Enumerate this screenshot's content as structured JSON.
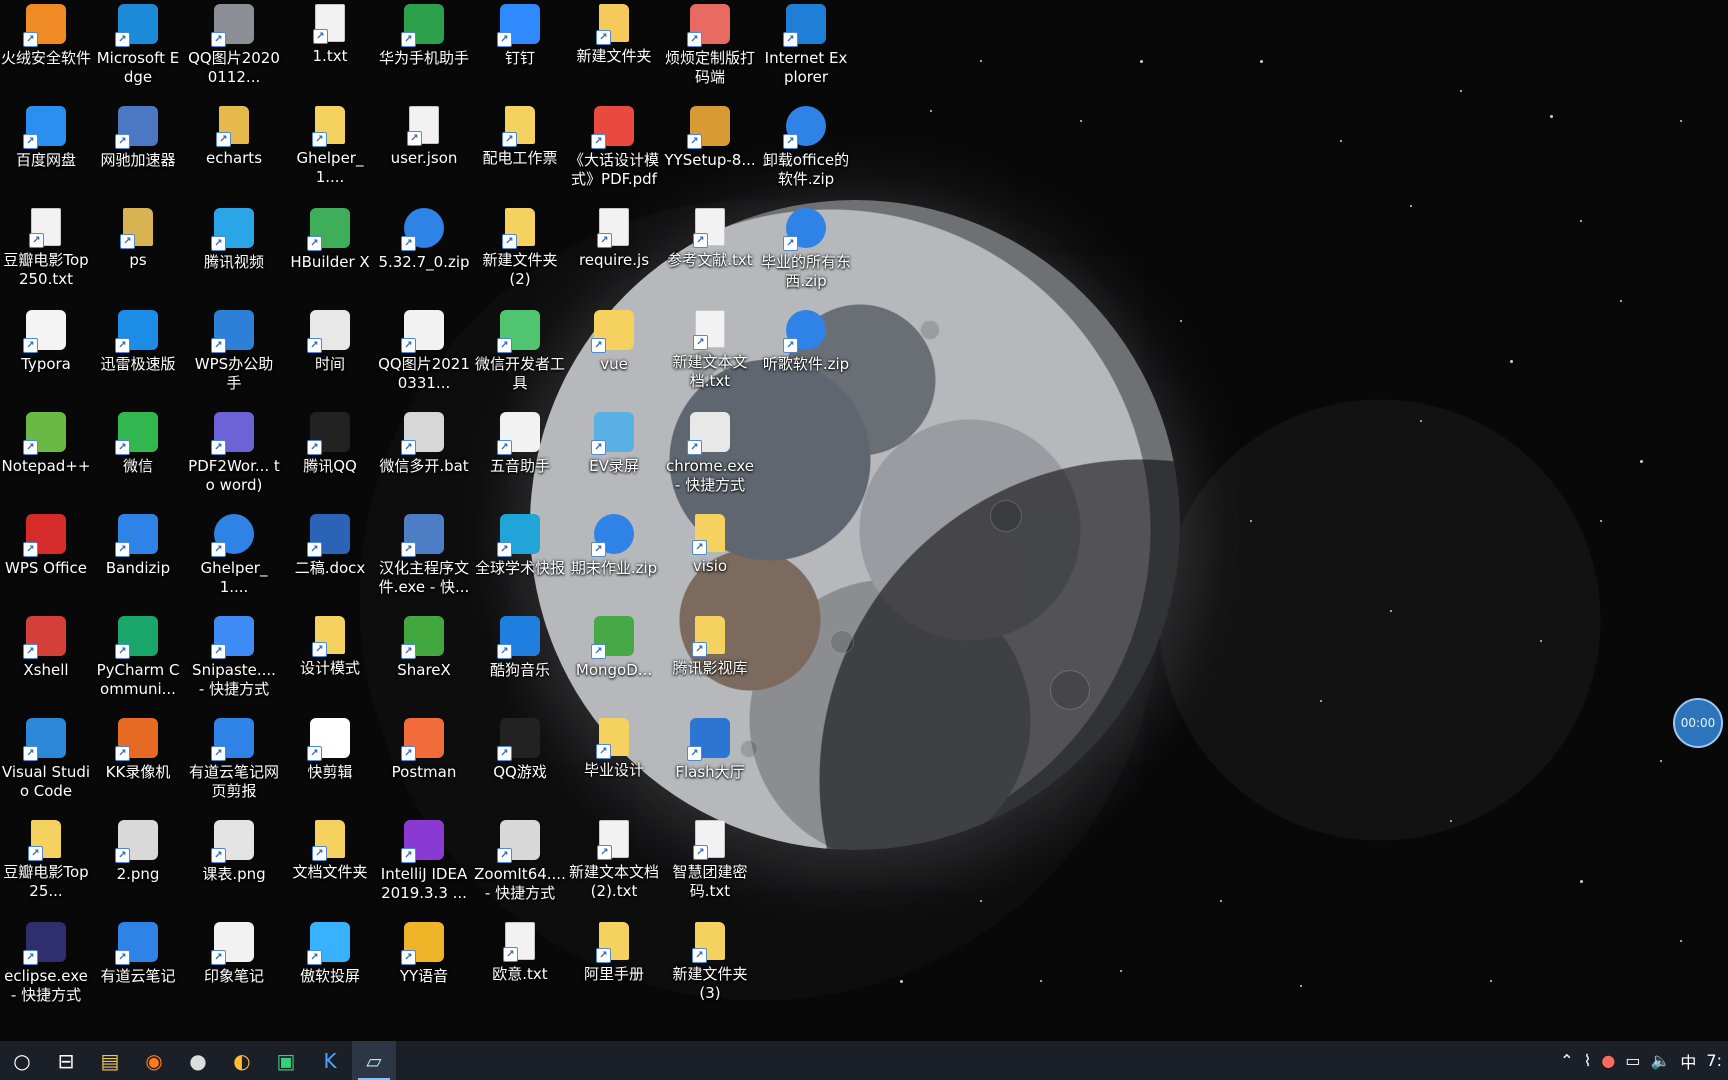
{
  "desktop": {
    "icons": [
      {
        "label": "火绒安全软件",
        "icon": "huorong-icon",
        "color": "#f08a24"
      },
      {
        "label": "Microsoft Edge",
        "icon": "edge-icon",
        "color": "#1b8ad8"
      },
      {
        "label": "QQ图片20200112...",
        "icon": "image-icon",
        "color": "#8c8e96"
      },
      {
        "label": "1.txt",
        "icon": "text-file-icon",
        "color": "#f2f2f2"
      },
      {
        "label": "华为手机助手",
        "icon": "huawei-icon",
        "color": "#2ca04b"
      },
      {
        "label": "钉钉",
        "icon": "dingtalk-icon",
        "color": "#2f89ff"
      },
      {
        "label": "新建文件夹",
        "icon": "folder-icon",
        "color": "#f5ca5b"
      },
      {
        "label": "烦烦定制版打码端",
        "icon": "app-icon",
        "color": "#e86b61"
      },
      {
        "label": "Internet Explorer",
        "icon": "ie-icon",
        "color": "#1f7fd6"
      },
      {
        "label": "百度网盘",
        "icon": "baidu-icon",
        "color": "#2a8ff0"
      },
      {
        "label": "网驰加速器",
        "icon": "vpn-icon",
        "color": "#4c78c3"
      },
      {
        "label": "echarts",
        "icon": "folder-icon",
        "color": "#e6b94d"
      },
      {
        "label": "Ghelper_1....",
        "icon": "folder-icon",
        "color": "#f5d15f"
      },
      {
        "label": "user.json",
        "icon": "json-icon",
        "color": "#f2f2f2"
      },
      {
        "label": "配电工作票",
        "icon": "folder-icon",
        "color": "#f5d15f"
      },
      {
        "label": "《大话设计模式》PDF.pdf",
        "icon": "pdf-icon",
        "color": "#e84a3f"
      },
      {
        "label": "YYSetup-8...",
        "icon": "installer-icon",
        "color": "#d89a35"
      },
      {
        "label": "卸载office的软件.zip",
        "icon": "zip-icon",
        "color": "#2f82e6"
      },
      {
        "label": "豆瓣电影Top 250.txt",
        "icon": "text-file-icon",
        "color": "#f2f2f2"
      },
      {
        "label": "ps",
        "icon": "folder-icon",
        "color": "#d9b352"
      },
      {
        "label": "腾讯视频",
        "icon": "tencent-video-icon",
        "color": "#2aa5e8"
      },
      {
        "label": "HBuilder X",
        "icon": "hbuilder-icon",
        "color": "#3fae5b"
      },
      {
        "label": "5.32.7_0.zip",
        "icon": "zip-icon",
        "color": "#2f82e6"
      },
      {
        "label": "新建文件夹 (2)",
        "icon": "folder-icon",
        "color": "#f5d15f"
      },
      {
        "label": "require.js",
        "icon": "script-icon",
        "color": "#f2f2f2"
      },
      {
        "label": "参考文献.txt",
        "icon": "text-file-icon",
        "color": "#f2f2f2"
      },
      {
        "label": "毕业的所有东西.zip",
        "icon": "zip-icon",
        "color": "#2f82e6"
      },
      {
        "label": "Typora",
        "icon": "typora-icon",
        "color": "#f4f4f4"
      },
      {
        "label": "迅雷极速版",
        "icon": "xunlei-icon",
        "color": "#1d8ce6"
      },
      {
        "label": "WPS办公助手",
        "icon": "wps-helper-icon",
        "color": "#2e7fd8"
      },
      {
        "label": "时间",
        "icon": "chrome-icon",
        "color": "#e8e8e8"
      },
      {
        "label": "QQ图片20210331...",
        "icon": "image-icon",
        "color": "#f2f2f2"
      },
      {
        "label": "微信开发者工具",
        "icon": "wechat-dev-icon",
        "color": "#4fc56f"
      },
      {
        "label": "vue",
        "icon": "chrome-icon",
        "color": "#f5d15f"
      },
      {
        "label": "新建文本文档.txt",
        "icon": "text-file-icon",
        "color": "#f2f2f2"
      },
      {
        "label": "听歌软件.zip",
        "icon": "zip-icon",
        "color": "#2f82e6"
      },
      {
        "label": "Notepad++",
        "icon": "notepad-plus-icon",
        "color": "#69b944"
      },
      {
        "label": "微信",
        "icon": "wechat-icon",
        "color": "#32b64f"
      },
      {
        "label": "PDF2Wor... to word)",
        "icon": "pdf2word-icon",
        "color": "#6d62d6"
      },
      {
        "label": "腾讯QQ",
        "icon": "qq-icon",
        "color": "#222222"
      },
      {
        "label": "微信多开.bat",
        "icon": "bat-icon",
        "color": "#d7d7d7"
      },
      {
        "label": "五音助手",
        "icon": "music-icon",
        "color": "#f2f2f2"
      },
      {
        "label": "EV录屏",
        "icon": "ev-icon",
        "color": "#5ab0e5"
      },
      {
        "label": "chrome.exe - 快捷方式",
        "icon": "chrome-icon",
        "color": "#e8e8e8"
      },
      {
        "label": "",
        "icon": "blank-icon",
        "color": "transparent"
      },
      {
        "label": "WPS Office",
        "icon": "wps-icon",
        "color": "#d62b2b"
      },
      {
        "label": "Bandizip",
        "icon": "bandizip-icon",
        "color": "#2f82e6"
      },
      {
        "label": "Ghelper_1....",
        "icon": "zip-icon",
        "color": "#2f82e6"
      },
      {
        "label": "二稿.docx",
        "icon": "word-icon",
        "color": "#2b63b7"
      },
      {
        "label": "汉化主程序文件.exe - 快...",
        "icon": "exe-icon",
        "color": "#4d7dc4"
      },
      {
        "label": "全球学术快报",
        "icon": "cnki-icon",
        "color": "#21a5d9"
      },
      {
        "label": "期末作业.zip",
        "icon": "zip-icon",
        "color": "#2f82e6"
      },
      {
        "label": "visio",
        "icon": "folder-icon",
        "color": "#f5d15f"
      },
      {
        "label": "",
        "icon": "blank-icon",
        "color": "transparent"
      },
      {
        "label": "Xshell",
        "icon": "xshell-icon",
        "color": "#d43f3a"
      },
      {
        "label": "PyCharm Communi...",
        "icon": "pycharm-icon",
        "color": "#1aa66b"
      },
      {
        "label": "Snipaste.... - 快捷方式",
        "icon": "snipaste-icon",
        "color": "#3f8bf5"
      },
      {
        "label": "设计模式",
        "icon": "folder-icon",
        "color": "#f5d15f"
      },
      {
        "label": "ShareX",
        "icon": "sharex-icon",
        "color": "#40a63d"
      },
      {
        "label": "酷狗音乐",
        "icon": "kugou-icon",
        "color": "#1f7fe0"
      },
      {
        "label": "MongoD...",
        "icon": "mongodb-icon",
        "color": "#46a847"
      },
      {
        "label": "腾讯影视库",
        "icon": "folder-icon",
        "color": "#f5d15f"
      },
      {
        "label": "",
        "icon": "blank-icon",
        "color": "transparent"
      },
      {
        "label": "Visual Studio Code",
        "icon": "vscode-icon",
        "color": "#2b88d8"
      },
      {
        "label": "KK录像机",
        "icon": "kk-icon",
        "color": "#e66a23"
      },
      {
        "label": "有道云笔记网页剪报",
        "icon": "youdao-clip-icon",
        "color": "#2f82e6"
      },
      {
        "label": "快剪辑",
        "icon": "clip-icon",
        "color": "#ffffff"
      },
      {
        "label": "Postman",
        "icon": "postman-icon",
        "color": "#f26b3a"
      },
      {
        "label": "QQ游戏",
        "icon": "qqgame-icon",
        "color": "#222222"
      },
      {
        "label": "毕业设计",
        "icon": "folder-icon",
        "color": "#f5d15f"
      },
      {
        "label": "Flash大厅",
        "icon": "flash-icon",
        "color": "#2d75d2"
      },
      {
        "label": "",
        "icon": "blank-icon",
        "color": "transparent"
      },
      {
        "label": "豆瓣电影Top 25...",
        "icon": "folder-icon",
        "color": "#f5d15f"
      },
      {
        "label": "2.png",
        "icon": "image-icon",
        "color": "#d9d9d9"
      },
      {
        "label": "课表.png",
        "icon": "image-icon",
        "color": "#e4e4e4"
      },
      {
        "label": "文档文件夹",
        "icon": "folder-icon",
        "color": "#f5d15f"
      },
      {
        "label": "IntelliJ IDEA 2019.3.3 ...",
        "icon": "idea-icon",
        "color": "#8a3ad3"
      },
      {
        "label": "ZoomIt64.... - 快捷方式",
        "icon": "zoomit-icon",
        "color": "#d8d8d8"
      },
      {
        "label": "新建文本文档 (2).txt",
        "icon": "text-file-icon",
        "color": "#f2f2f2"
      },
      {
        "label": "智慧团建密码.txt",
        "icon": "text-file-icon",
        "color": "#f2f2f2"
      },
      {
        "label": "",
        "icon": "blank-icon",
        "color": "transparent"
      },
      {
        "label": "eclipse.exe - 快捷方式",
        "icon": "eclipse-icon",
        "color": "#2f2f6e"
      },
      {
        "label": "有道云笔记",
        "icon": "youdao-icon",
        "color": "#2f82e6"
      },
      {
        "label": "印象笔记",
        "icon": "evernote-icon",
        "color": "#f2f2f2"
      },
      {
        "label": "傲软投屏",
        "icon": "apowersoft-icon",
        "color": "#37b2ff"
      },
      {
        "label": "YY语音",
        "icon": "yy-icon",
        "color": "#f0b428"
      },
      {
        "label": "欧意.txt",
        "icon": "text-file-icon",
        "color": "#f2f2f2"
      },
      {
        "label": "阿里手册",
        "icon": "folder-icon",
        "color": "#f5d15f"
      },
      {
        "label": "新建文件夹 (3)",
        "icon": "folder-icon",
        "color": "#f5d15f"
      },
      {
        "label": "",
        "icon": "blank-icon",
        "color": "transparent"
      }
    ]
  },
  "timer": {
    "text": "00:00"
  },
  "taskbar": {
    "items": [
      {
        "icon": "search-circle-icon",
        "text": "○"
      },
      {
        "icon": "task-view-icon",
        "text": "⊟"
      },
      {
        "icon": "file-explorer-icon",
        "text": "▤"
      },
      {
        "icon": "firefox-icon",
        "text": "◉"
      },
      {
        "icon": "app-round-icon",
        "text": "●"
      },
      {
        "icon": "chrome-icon",
        "text": "◐"
      },
      {
        "icon": "pycharm-icon",
        "text": "▣"
      },
      {
        "icon": "kugou-icon",
        "text": "K"
      },
      {
        "icon": "active-window-icon",
        "text": "▱"
      }
    ],
    "tray": {
      "chevron": "⌃",
      "wifi": "⌇",
      "user": "●",
      "battery": "▭",
      "volume": "🔈",
      "ime": "中",
      "time": "7:"
    }
  }
}
